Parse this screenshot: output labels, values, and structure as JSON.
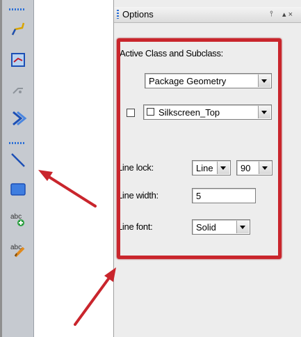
{
  "panel": {
    "title": "Options",
    "pin_icon": "pin-icon",
    "close_label": "▴ ×"
  },
  "options": {
    "active_class_label": "Active Class and Subclass:",
    "class_value": "Package Geometry",
    "subclass_value": "Silkscreen_Top",
    "subclass_checked": false,
    "line_lock_label": "Line lock:",
    "line_lock_type": "Line",
    "line_lock_angle": "90",
    "line_width_label": "Line width:",
    "line_width_value": "5",
    "line_font_label": "Line font:",
    "line_font_value": "Solid"
  },
  "toolbar": {
    "tools": [
      "route-connect-icon",
      "add-connect-icon",
      "slide-icon",
      "shape-icon",
      "add-line-icon",
      "add-rect-icon",
      "add-text-icon",
      "edit-text-icon"
    ]
  },
  "colors": {
    "highlight": "#c9252c",
    "arrow": "#c9252c",
    "grip": "#2b6fd6"
  }
}
